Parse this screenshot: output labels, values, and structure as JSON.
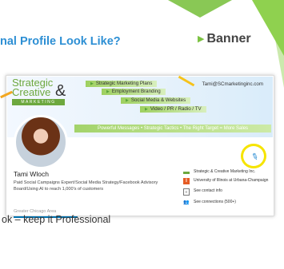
{
  "slide": {
    "title": "nal Profile Look Like?",
    "banner_label": "Banner",
    "bullet": "ok – keep it Professional"
  },
  "banner": {
    "logo_line1": "Strategic",
    "logo_line2": "Creative",
    "logo_amp": "&",
    "logo_bar": "MARKETING",
    "pills": [
      "Strategic Marketing Plans",
      "Employment Branding",
      "Social Media & Websites",
      "Video / PR / Radio / TV"
    ],
    "email": "Tami@SCmarketinginc.com",
    "message": "Powerful Messages • Strategic Tactics • The Right Target = More Sales"
  },
  "profile": {
    "name": "Tami Wloch",
    "headline": "Paid Social Campaigns Expert/Social Media Strategy/Facebook Advisory Board/Using AI to reach 1,000's of customers",
    "location": "Greater Chicago Area"
  },
  "sidebar": {
    "company": "Strategic & Creative Marketing Inc.",
    "school": "University of Illinois at Urbana-Champaign",
    "contact": "See contact info",
    "connections": "See connections (500+)"
  },
  "icons": {
    "edit": "pencil-icon",
    "contact": "contact-card-icon",
    "connections": "people-icon",
    "school": "university-logo-icon"
  },
  "colors": {
    "title_blue": "#2d8fd4",
    "accent_green": "#7cc242",
    "highlight_yellow": "#f6e400",
    "arrow_orange": "#f3a71f"
  }
}
